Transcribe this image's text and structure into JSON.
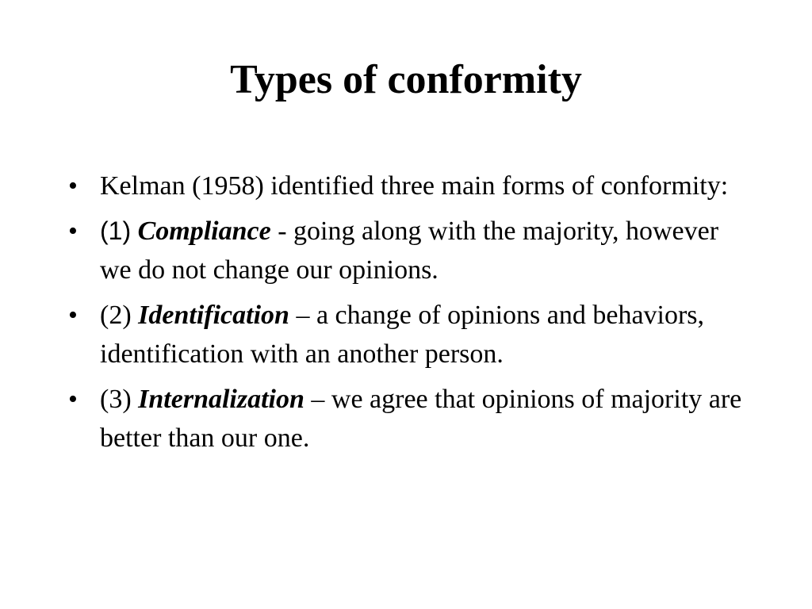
{
  "slide": {
    "title": "Types of conformity",
    "bullet_symbol": "•",
    "bullets": [
      {
        "text": "Kelman (1958) identified three main forms of conformity:"
      },
      {
        "prefix": "(1)",
        "term": "Compliance",
        "rest": "  - going along with the majority, however we do not change our opinions."
      },
      {
        "prefix": "(2)",
        "term": "Identification",
        "rest": " – a change of opinions and behaviors, identification with an another person."
      },
      {
        "prefix": "(3)",
        "term": "Internalization",
        "rest": " – we agree that opinions of majority are better than our one."
      }
    ]
  }
}
